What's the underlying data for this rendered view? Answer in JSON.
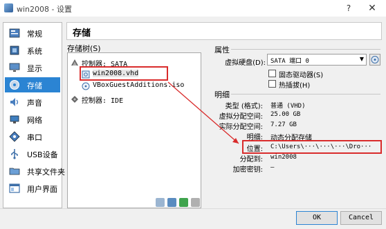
{
  "window": {
    "title": "win2008 - 设置",
    "help": "?",
    "close": "✕"
  },
  "sidebar": {
    "items": [
      {
        "label": "常规",
        "icon": "general-icon"
      },
      {
        "label": "系统",
        "icon": "system-icon"
      },
      {
        "label": "显示",
        "icon": "display-icon"
      },
      {
        "label": "存储",
        "icon": "storage-icon"
      },
      {
        "label": "声音",
        "icon": "audio-icon"
      },
      {
        "label": "网络",
        "icon": "network-icon"
      },
      {
        "label": "串口",
        "icon": "serial-port-icon"
      },
      {
        "label": "USB设备",
        "icon": "usb-icon"
      },
      {
        "label": "共享文件夹",
        "icon": "shared-folder-icon"
      },
      {
        "label": "用户界面",
        "icon": "user-interface-icon"
      }
    ],
    "selected": "存储"
  },
  "page": {
    "title": "存储"
  },
  "storage_tree": {
    "label": "存储树(S)",
    "controller_sata": "控制器: SATA",
    "disk_vhd": "win2008.vhd",
    "optical_iso": "VBoxGuestAdditions.iso",
    "controller_ide": "控制器: IDE"
  },
  "attributes": {
    "heading": "属性",
    "hard_disk_label": "虚拟硬盘(D):",
    "hard_disk_value": "SATA 端口 0",
    "solid_state": "固态驱动器(S)",
    "hot_plug": "热插拔(H)"
  },
  "info": {
    "heading": "明细",
    "rows": [
      {
        "label": "类型 (格式):",
        "value": "普通 (VHD)"
      },
      {
        "label": "虚拟分配空间:",
        "value": "25.00 GB"
      },
      {
        "label": "实际分配空间:",
        "value": "7.27 GB"
      },
      {
        "label": "明细:",
        "value": "动态分配存储"
      },
      {
        "label": "位置:",
        "value": "C:\\Users\\···\\···\\···\\Dro···"
      },
      {
        "label": "分配到:",
        "value": "win2008"
      },
      {
        "label": "加密密钥:",
        "value": "—"
      }
    ]
  },
  "buttons": {
    "ok": "OK",
    "cancel": "Cancel"
  },
  "colors": {
    "selection": "#2b84d3",
    "highlight_box": "#d92b2b"
  }
}
